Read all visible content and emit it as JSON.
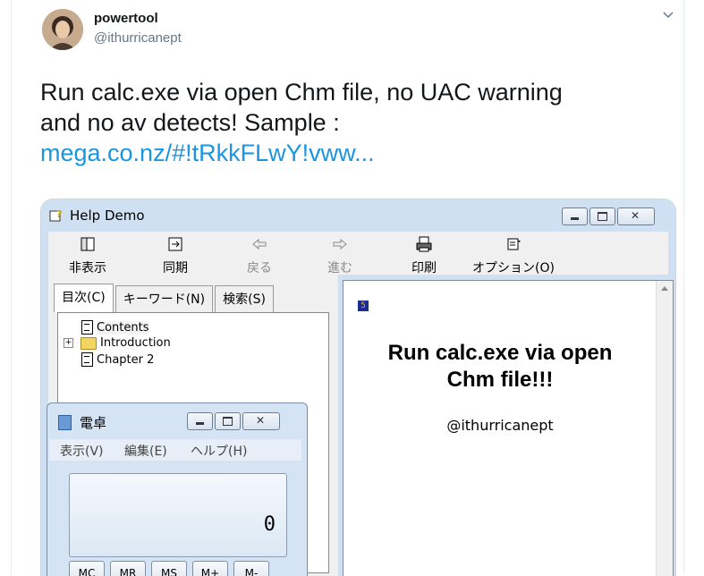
{
  "tweet": {
    "display_name": "powertool",
    "handle": "@ithurricanept",
    "text_line1": "Run calc.exe via open Chm file, no UAC warning",
    "text_line2": "and no av detects!  Sample :",
    "link": "mega.co.nz/#!tRkkFLwY!vww..."
  },
  "help_window": {
    "title": "Help Demo",
    "toolbar": [
      {
        "label": "非表示",
        "icon": "hide-icon",
        "enabled": true
      },
      {
        "label": "同期",
        "icon": "sync-icon",
        "enabled": true
      },
      {
        "label": "戻る",
        "icon": "back-arrow-icon",
        "enabled": false
      },
      {
        "label": "進む",
        "icon": "forward-arrow-icon",
        "enabled": false
      },
      {
        "label": "印刷",
        "icon": "print-icon",
        "enabled": true
      },
      {
        "label": "オプション(O)",
        "icon": "options-icon",
        "enabled": true
      }
    ],
    "tabs": [
      "目次(C)",
      "キーワード(N)",
      "検索(S)"
    ],
    "tree": [
      {
        "label": "Contents",
        "type": "page"
      },
      {
        "label": "Introduction",
        "type": "folder"
      },
      {
        "label": "Chapter 2",
        "type": "page"
      }
    ],
    "content_title_line1": "Run calc.exe via open",
    "content_title_line2": "Chm file!!!",
    "content_handle": "@ithurricanept"
  },
  "calculator": {
    "title": "電卓",
    "menu": [
      "表示(V)",
      "編集(E)",
      "ヘルプ(H)"
    ],
    "display": "0",
    "buttons": [
      "MC",
      "MR",
      "MS",
      "M+",
      "M-"
    ]
  },
  "colors": {
    "link": "#1b95e0",
    "window_frame": "#cfe0f3",
    "calc_frame": "#d5e4f4"
  }
}
